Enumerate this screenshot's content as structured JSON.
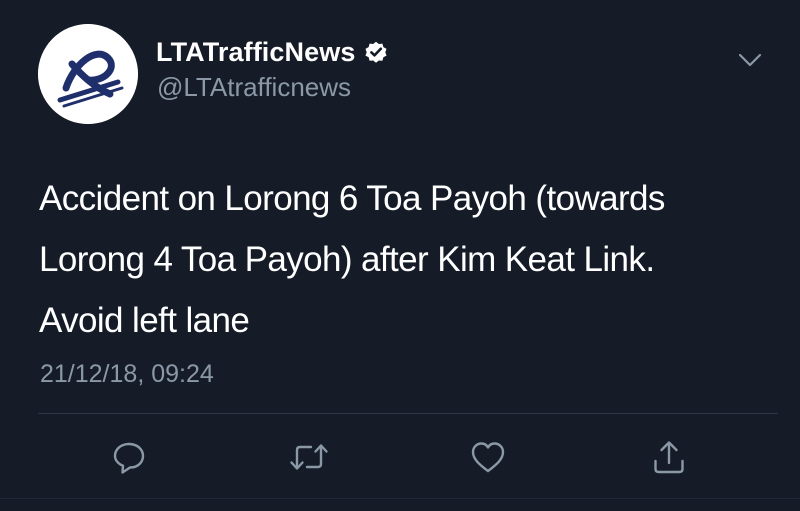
{
  "tweet": {
    "author": {
      "display_name": "LTATrafficNews",
      "handle": "@LTAtrafficnews",
      "verified": true,
      "avatar_icon": "lta-logo-icon"
    },
    "text_lines": [
      "Accident on Lorong 6 Toa Payoh (towards",
      "Lorong 4 Toa Payoh) after Kim Keat Link.",
      "Avoid left lane"
    ],
    "timestamp": "21/12/18, 09:24",
    "actions": [
      {
        "name": "reply",
        "icon": "reply-icon"
      },
      {
        "name": "retweet",
        "icon": "retweet-icon"
      },
      {
        "name": "like",
        "icon": "heart-icon"
      },
      {
        "name": "share",
        "icon": "share-icon"
      }
    ]
  },
  "colors": {
    "background": "#151c27",
    "text_primary": "#ffffff",
    "text_secondary": "#8b98a6",
    "verified_badge": "#ffffff",
    "divider": "#2c3846",
    "logo_navy": "#1f2f6b"
  }
}
